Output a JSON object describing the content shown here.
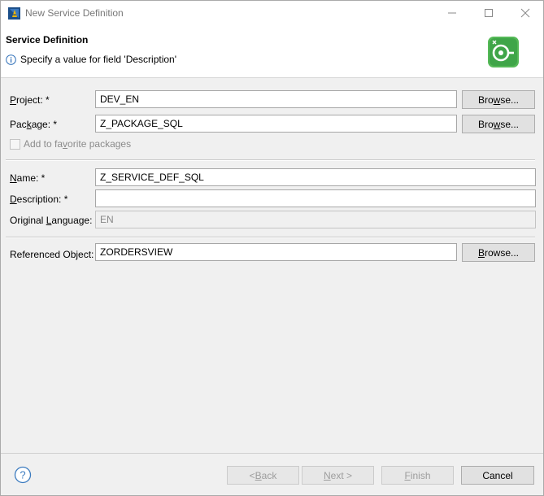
{
  "window": {
    "title": "New Service Definition",
    "icons": {
      "app": "sap-adt-icon",
      "minimize": "minimize-icon",
      "maximize": "maximize-icon",
      "close": "close-icon"
    }
  },
  "header": {
    "title": "Service Definition",
    "message": "Specify a value for field 'Description'",
    "message_icon": "info-icon",
    "banner_icon": "service-definition-icon"
  },
  "form": {
    "project": {
      "label_pre": "",
      "label_u": "P",
      "label_post": "roject: *",
      "value": "DEV_EN",
      "browse_pre": "Bro",
      "browse_u": "w",
      "browse_post": "se..."
    },
    "package": {
      "label_pre": "Pac",
      "label_u": "k",
      "label_post": "age: *",
      "value": "Z_PACKAGE_SQL",
      "browse_pre": "Bro",
      "browse_u": "w",
      "browse_post": "se..."
    },
    "favorite": {
      "label_pre": "Add to fa",
      "label_u": "v",
      "label_post": "orite packages",
      "checked": false
    },
    "name": {
      "label_pre": "",
      "label_u": "N",
      "label_post": "ame: *",
      "value": "Z_SERVICE_DEF_SQL"
    },
    "description": {
      "label_pre": "",
      "label_u": "D",
      "label_post": "escription: *",
      "value": ""
    },
    "language": {
      "label_pre": "Original ",
      "label_u": "L",
      "label_post": "anguage:",
      "value": "EN"
    },
    "referenced": {
      "label": "Referenced Object:",
      "value": "ZORDERSVIEW",
      "browse_pre": "",
      "browse_u": "B",
      "browse_post": "rowse..."
    }
  },
  "footer": {
    "help_icon": "help-icon",
    "back": {
      "pre": "< ",
      "u": "B",
      "post": "ack"
    },
    "next": {
      "pre": "",
      "u": "N",
      "post": "ext >"
    },
    "finish": {
      "pre": "",
      "u": "F",
      "post": "inish"
    },
    "cancel": "Cancel"
  }
}
